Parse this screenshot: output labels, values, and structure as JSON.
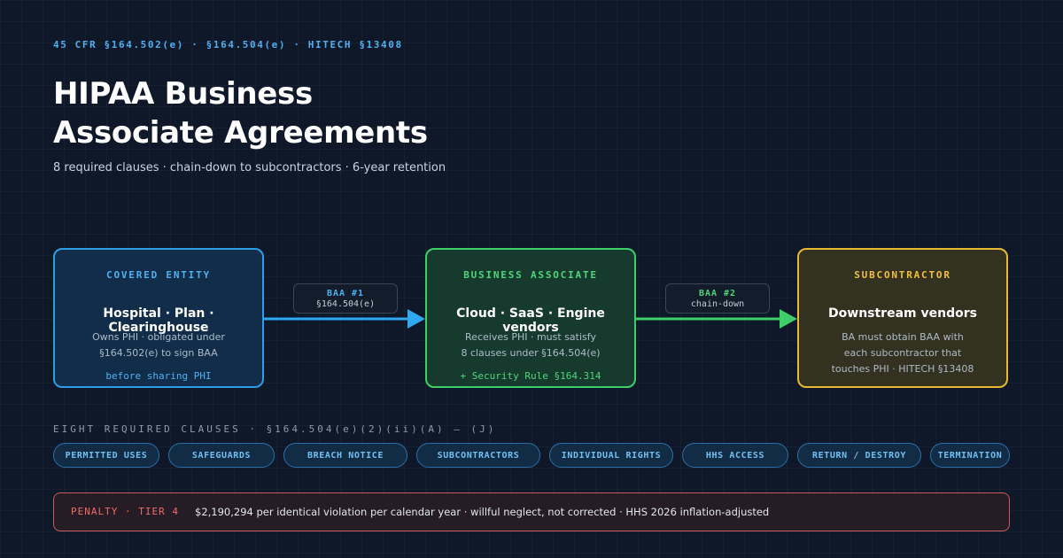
{
  "header": {
    "kicker": "45 CFR §164.502(e) · §164.504(e) · HITECH §13408",
    "title_line1": "HIPAA Business",
    "title_line2": "Associate Agreements",
    "subtitle": "8 required clauses · chain-down to subcontractors · 6-year retention"
  },
  "diagram": {
    "nodes": [
      {
        "label": "COVERED ENTITY",
        "heading": "Hospital · Plan · Clearinghouse",
        "desc_line1": "Owns PHI · obligated under",
        "desc_line2": "§164.502(e) to sign BAA",
        "footer": "before sharing PHI"
      },
      {
        "label": "BUSINESS ASSOCIATE",
        "heading": "Cloud · SaaS · Engine vendors",
        "desc_line1": "Receives PHI · must satisfy",
        "desc_line2": "8 clauses under §164.504(e)",
        "footer": "+ Security Rule §164.314"
      },
      {
        "label": "SUBCONTRACTOR",
        "heading": "Downstream vendors",
        "desc_line1": "BA must obtain BAA with",
        "desc_line2": "each subcontractor that",
        "desc_line3": "touches PHI · HITECH §13408"
      }
    ],
    "edges": [
      {
        "from": 0,
        "to": 1,
        "title": "BAA #1",
        "subtitle": "§164.504(e)",
        "color": "#2ea8f0"
      },
      {
        "from": 1,
        "to": 2,
        "title": "BAA #2",
        "subtitle": "chain-down",
        "color": "#3ccf6a"
      }
    ]
  },
  "clauses": {
    "heading": "EIGHT REQUIRED CLAUSES · §164.504(e)(2)(ii)(A) – (J)",
    "items": [
      "PERMITTED USES",
      "SAFEGUARDS",
      "BREACH NOTICE",
      "SUBCONTRACTORS",
      "INDIVIDUAL RIGHTS",
      "HHS ACCESS",
      "RETURN / DESTROY",
      "TERMINATION"
    ]
  },
  "penalty": {
    "label": "PENALTY · TIER 4",
    "text": "$2,190,294 per identical violation per calendar year · willful neglect, not corrected · HHS 2026 inflation-adjusted"
  },
  "colors": {
    "background": "#0f1828",
    "covered_entity": "#2e9de4",
    "business_associate": "#3ccf6a",
    "subcontractor": "#e8b733",
    "penalty": "#c95a5e"
  }
}
